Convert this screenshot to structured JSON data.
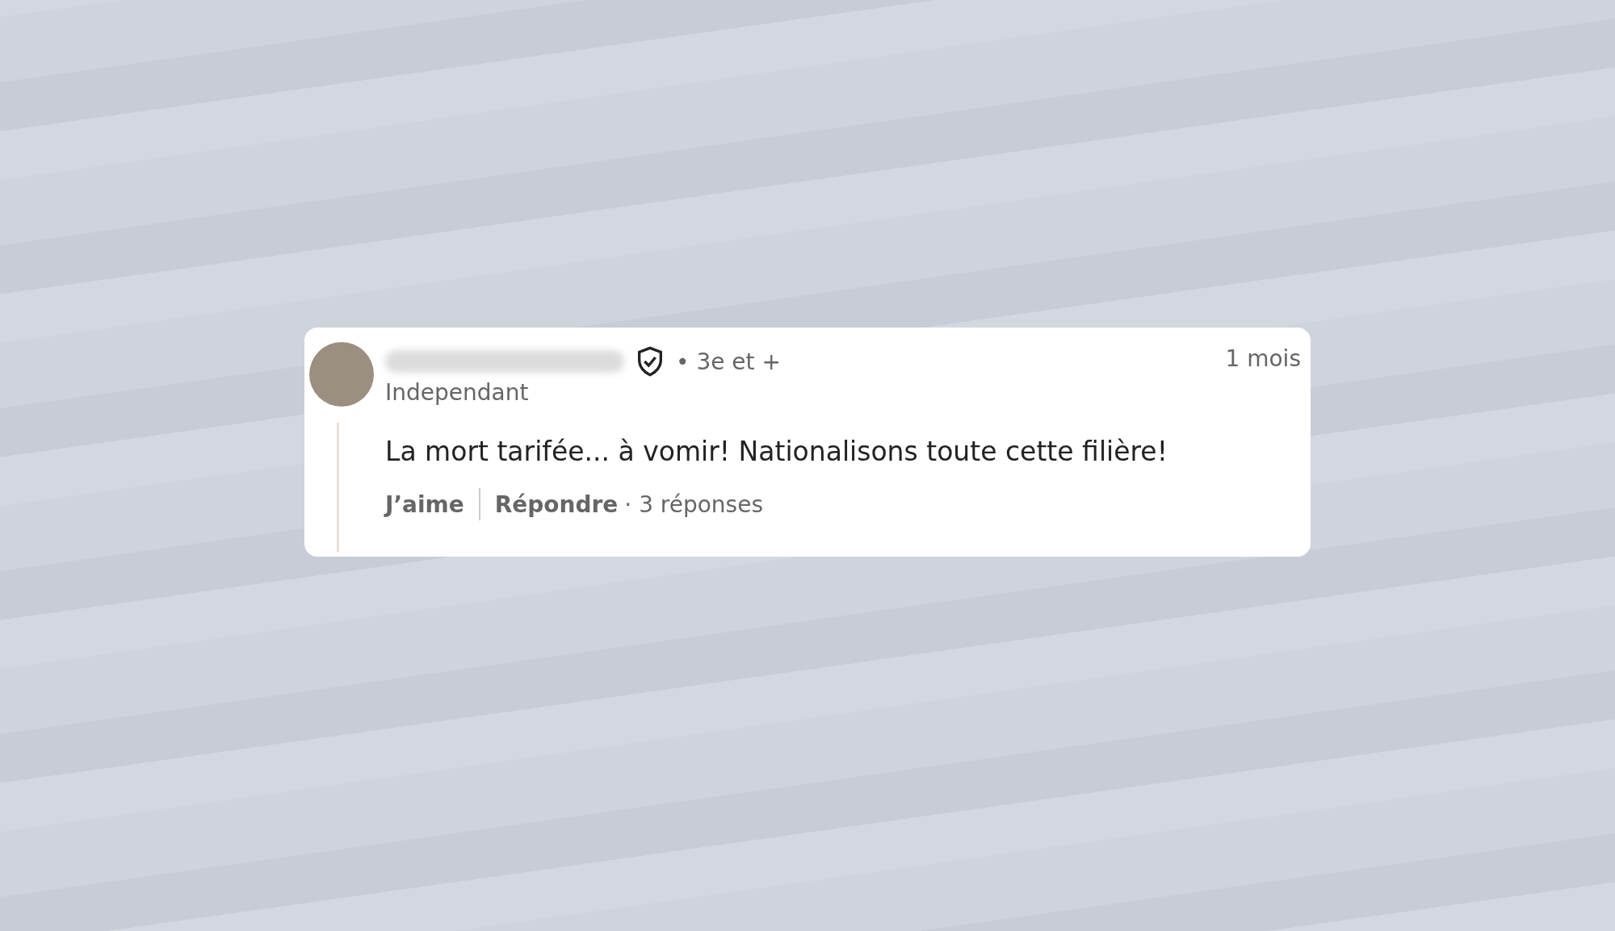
{
  "comment": {
    "author": {
      "connection": "• 3e et +",
      "headline": "Independant"
    },
    "time": "1 mois",
    "text": "La mort tarifée... à vomir! Nationalisons toute cette filière!",
    "actions": {
      "like": "J’aime",
      "reply": "Répondre",
      "replies": "· 3 réponses"
    }
  }
}
